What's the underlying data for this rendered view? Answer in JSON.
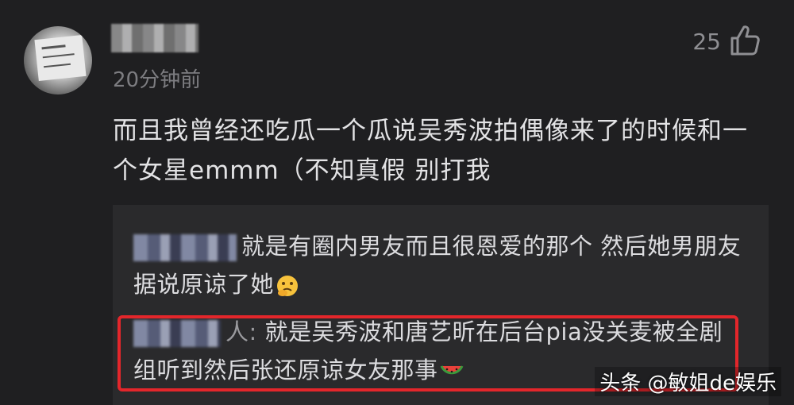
{
  "comment": {
    "timestamp": "20分钟前",
    "like_count": "25",
    "text": "而且我曾经还吃瓜一个瓜说吴秀波拍偶像来了的时候和一个女星emmm（不知真假 别打我"
  },
  "replies": [
    {
      "text": "就是有圈内男友而且很恩爱的那个 然后她男朋友据说原谅了她",
      "emoji": "thinking-face-icon"
    },
    {
      "suffix": "人",
      "text": "就是吴秀波和唐艺昕在后台pia没关麦被全剧组听到然后张还原谅女友那事",
      "emoji": "watermelon-icon"
    }
  ],
  "watermark": "头条 @敏姐de娱乐",
  "colors": {
    "background": "#1f1f21",
    "reply_background": "#2a2a2c",
    "highlight_border": "#e3262b"
  }
}
